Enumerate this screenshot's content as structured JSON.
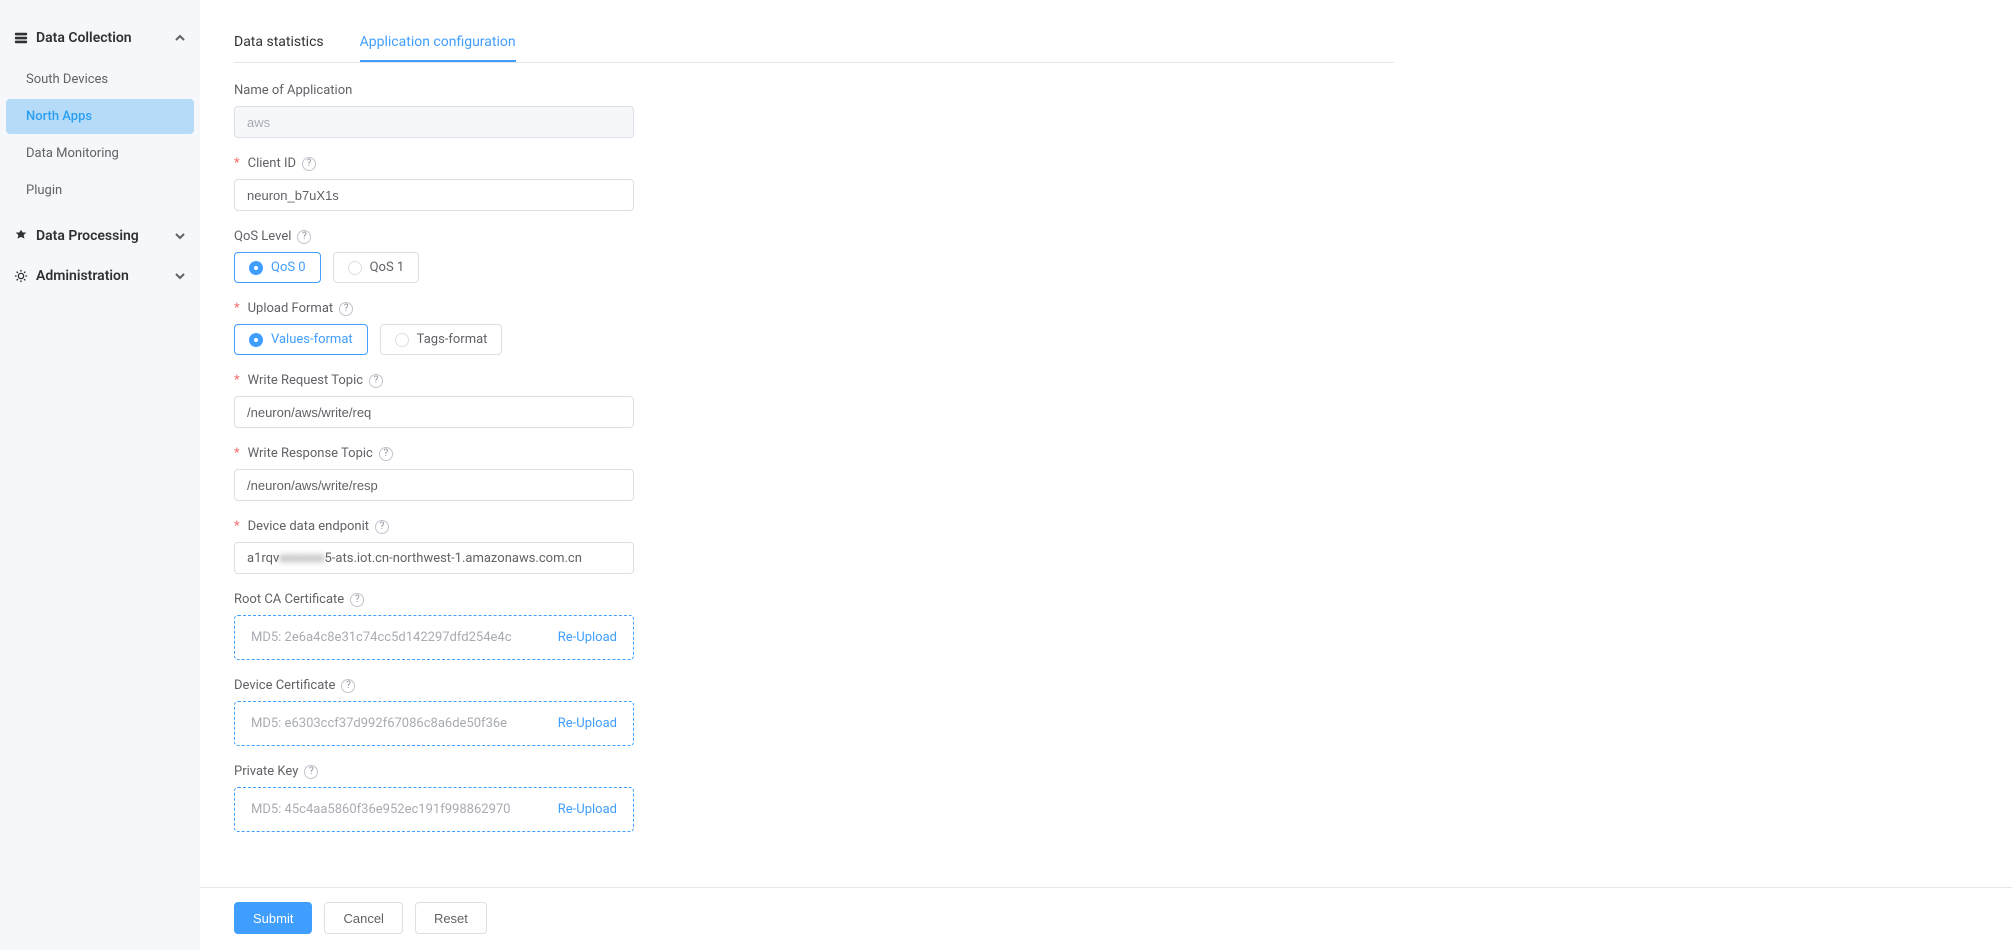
{
  "sidebar": {
    "groups": [
      {
        "label": "Data Collection",
        "expanded": true,
        "items": [
          {
            "label": "South Devices",
            "active": false
          },
          {
            "label": "North Apps",
            "active": true
          },
          {
            "label": "Data Monitoring",
            "active": false
          },
          {
            "label": "Plugin",
            "active": false
          }
        ]
      },
      {
        "label": "Data Processing",
        "expanded": false
      },
      {
        "label": "Administration",
        "expanded": false
      }
    ]
  },
  "tabs": [
    {
      "label": "Data statistics",
      "active": false
    },
    {
      "label": "Application configuration",
      "active": true
    }
  ],
  "form": {
    "app_name": {
      "label": "Name of Application",
      "value": "aws"
    },
    "client_id": {
      "label": "Client ID",
      "value": "neuron_b7uX1s"
    },
    "qos": {
      "label": "QoS Level",
      "options": [
        "QoS 0",
        "QoS 1"
      ],
      "selected": 0
    },
    "upload_format": {
      "label": "Upload Format",
      "options": [
        "Values-format",
        "Tags-format"
      ],
      "selected": 0
    },
    "write_req": {
      "label": "Write Request Topic",
      "value": "/neuron/aws/write/req"
    },
    "write_resp": {
      "label": "Write Response Topic",
      "value": "/neuron/aws/write/resp"
    },
    "endpoint": {
      "label": "Device data endponit",
      "value_prefix": "a1rqv",
      "value_blur": "xxxxxxx",
      "value_suffix": "5-ats.iot.cn-northwest-1.amazonaws.com.cn"
    },
    "root_ca": {
      "label": "Root CA Certificate",
      "md5": "MD5: 2e6a4c8e31c74cc5d142297dfd254e4c",
      "action": "Re-Upload"
    },
    "dev_cert": {
      "label": "Device Certificate",
      "md5": "MD5: e6303ccf37d992f67086c8a6de50f36e",
      "action": "Re-Upload"
    },
    "priv_key": {
      "label": "Private Key",
      "md5": "MD5: 45c4aa5860f36e952ec191f998862970",
      "action": "Re-Upload"
    }
  },
  "footer": {
    "submit": "Submit",
    "cancel": "Cancel",
    "reset": "Reset"
  }
}
